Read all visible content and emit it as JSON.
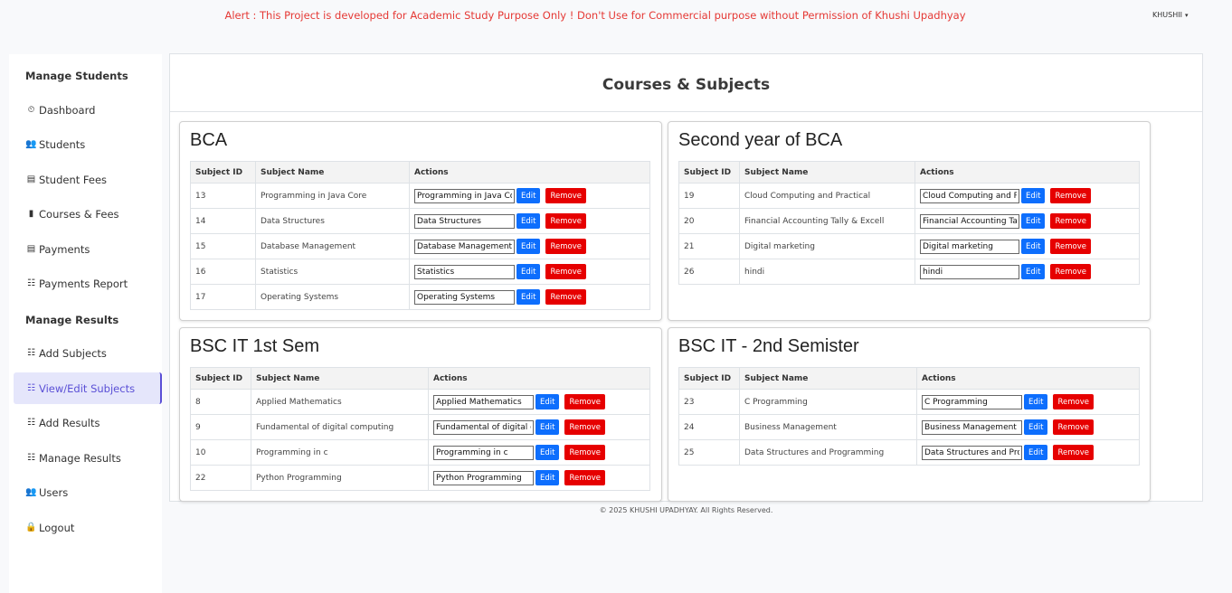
{
  "alert": "Alert : This Project is developed for Academic Study Purpose Only ! Don't Use for Commercial purpose without Permission of Khushi Upadhyay",
  "user": {
    "name": "KHUSHII",
    "caret": "▾"
  },
  "sidebar": {
    "heading_students": "Manage Students",
    "heading_results": "Manage Results",
    "items": [
      {
        "label": "Dashboard",
        "icon": "⏲"
      },
      {
        "label": "Students",
        "icon": "👥"
      },
      {
        "label": "Student Fees",
        "icon": "▤"
      },
      {
        "label": "Courses & Fees",
        "icon": "▮"
      },
      {
        "label": "Payments",
        "icon": "▤"
      },
      {
        "label": "Payments Report",
        "icon": "☷"
      },
      {
        "label": "Add Subjects",
        "icon": "☷"
      },
      {
        "label": "View/Edit Subjects",
        "icon": "☷"
      },
      {
        "label": "Add Results",
        "icon": "☷"
      },
      {
        "label": "Manage Results",
        "icon": "☷"
      },
      {
        "label": "Users",
        "icon": "👥"
      },
      {
        "label": "Logout",
        "icon": "🔒"
      }
    ]
  },
  "page_title": "Courses & Subjects",
  "table_headers": {
    "id": "Subject ID",
    "name": "Subject Name",
    "actions": "Actions"
  },
  "buttons": {
    "edit": "Edit",
    "remove": "Remove"
  },
  "courses": [
    {
      "title": "BCA",
      "subjects": [
        {
          "id": "13",
          "name": "Programming in Java Core"
        },
        {
          "id": "14",
          "name": "Data Structures"
        },
        {
          "id": "15",
          "name": "Database Management"
        },
        {
          "id": "16",
          "name": "Statistics"
        },
        {
          "id": "17",
          "name": "Operating Systems"
        }
      ]
    },
    {
      "title": "Second year of BCA",
      "subjects": [
        {
          "id": "19",
          "name": "Cloud Computing and Practical"
        },
        {
          "id": "20",
          "name": "Financial Accounting Tally & Excell"
        },
        {
          "id": "21",
          "name": "Digital marketing"
        },
        {
          "id": "26",
          "name": "hindi"
        }
      ]
    },
    {
      "title": "BSC IT 1st Sem",
      "subjects": [
        {
          "id": "8",
          "name": "Applied Mathematics"
        },
        {
          "id": "9",
          "name": "Fundamental of digital computing"
        },
        {
          "id": "10",
          "name": "Programming in c"
        },
        {
          "id": "22",
          "name": "Python Programming"
        }
      ]
    },
    {
      "title": "BSC IT - 2nd Semister",
      "subjects": [
        {
          "id": "23",
          "name": "C Programming"
        },
        {
          "id": "24",
          "name": "Business Management"
        },
        {
          "id": "25",
          "name": "Data Structures and Programming"
        }
      ]
    }
  ],
  "footer": "© 2025 KHUSHI UPADHYAY. All Rights Reserved.",
  "colors": {
    "alert": "#e53935",
    "accent": "#5a4fd6",
    "edit": "#0d6efd",
    "remove": "#e60000"
  }
}
